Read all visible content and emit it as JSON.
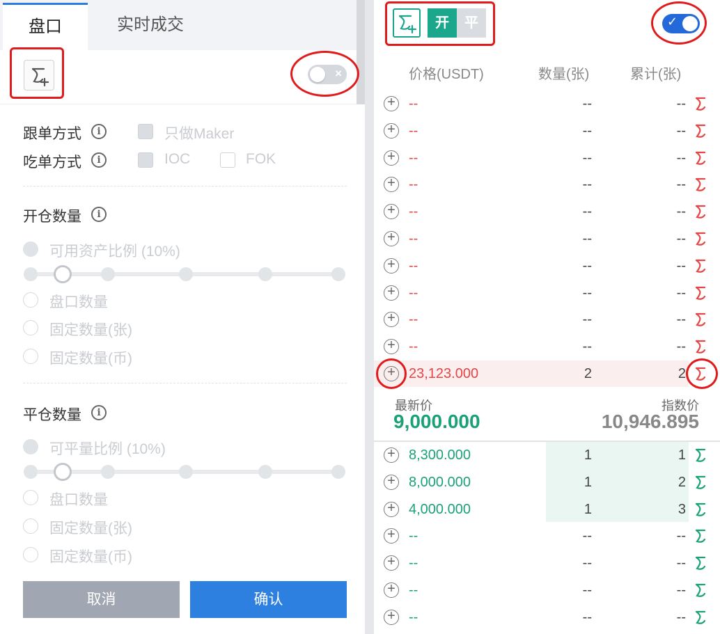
{
  "left_panel": {
    "tabs": [
      {
        "label": "盘口",
        "active": true
      },
      {
        "label": "实时成交",
        "active": false
      }
    ],
    "follow_label": "跟单方式",
    "maker_label": "只做Maker",
    "take_label": "吃单方式",
    "ioc_label": "IOC",
    "fok_label": "FOK",
    "open_section": {
      "title": "开仓数量",
      "ratio_label": "可用资产比例 (10%)",
      "ratio_value": 10,
      "options": [
        "盘口数量",
        "固定数量(张)",
        "固定数量(币)"
      ]
    },
    "close_section": {
      "title": "平仓数量",
      "ratio_label": "可平量比例 (10%)",
      "ratio_value": 10,
      "options": [
        "盘口数量",
        "固定数量(张)",
        "固定数量(币)"
      ]
    },
    "cancel_label": "取消",
    "confirm_label": "确认"
  },
  "right_panel": {
    "open_label": "开",
    "close_label": "平",
    "headers": {
      "price": "价格(USDT)",
      "qty": "数量(张)",
      "cum": "累计(张)"
    },
    "asks": [
      {
        "price": "--",
        "qty": "--",
        "cum": "--"
      },
      {
        "price": "--",
        "qty": "--",
        "cum": "--"
      },
      {
        "price": "--",
        "qty": "--",
        "cum": "--"
      },
      {
        "price": "--",
        "qty": "--",
        "cum": "--"
      },
      {
        "price": "--",
        "qty": "--",
        "cum": "--"
      },
      {
        "price": "--",
        "qty": "--",
        "cum": "--"
      },
      {
        "price": "--",
        "qty": "--",
        "cum": "--"
      },
      {
        "price": "--",
        "qty": "--",
        "cum": "--"
      },
      {
        "price": "--",
        "qty": "--",
        "cum": "--"
      },
      {
        "price": "--",
        "qty": "--",
        "cum": "--"
      },
      {
        "price": "23,123.000",
        "qty": "2",
        "cum": "2"
      }
    ],
    "last_price_label": "最新价",
    "last_price": "9,000.000",
    "index_price_label": "指数价",
    "index_price": "10,946.895",
    "bids": [
      {
        "price": "8,300.000",
        "qty": "1",
        "cum": "1"
      },
      {
        "price": "8,000.000",
        "qty": "1",
        "cum": "2"
      },
      {
        "price": "4,000.000",
        "qty": "1",
        "cum": "3"
      },
      {
        "price": "--",
        "qty": "--",
        "cum": "--"
      },
      {
        "price": "--",
        "qty": "--",
        "cum": "--"
      },
      {
        "price": "--",
        "qty": "--",
        "cum": "--"
      },
      {
        "price": "--",
        "qty": "--",
        "cum": "--"
      }
    ],
    "colors": {
      "ask": "#e64545",
      "bid": "#1aa178",
      "accent": "#2d7fe0"
    }
  }
}
